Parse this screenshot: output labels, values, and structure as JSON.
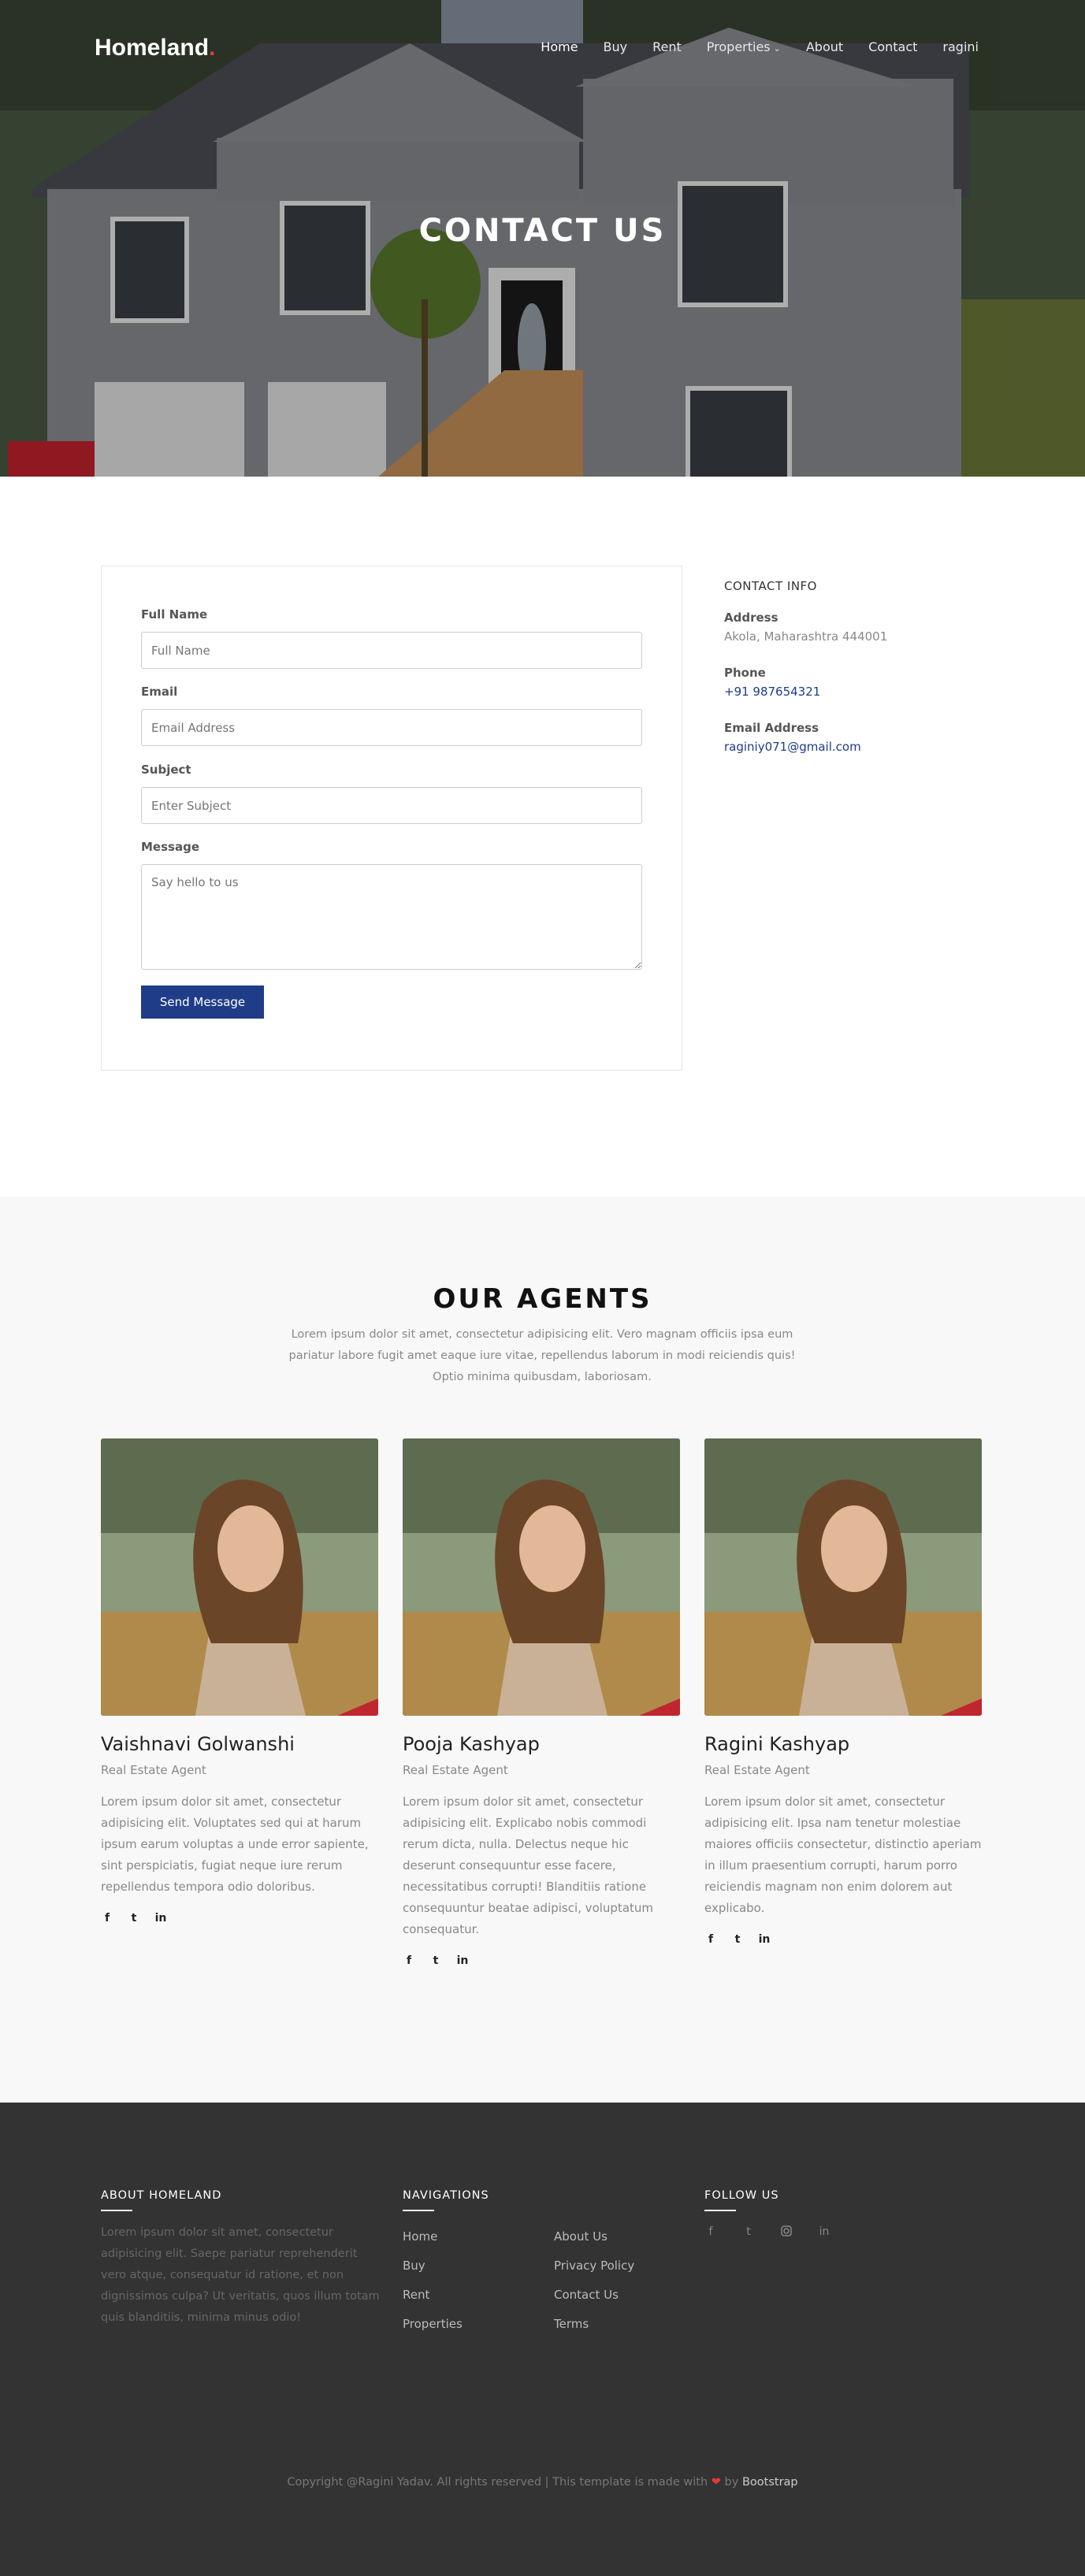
{
  "header": {
    "brand": "Homeland",
    "brand_dot": ".",
    "nav": [
      "Home",
      "Buy",
      "Rent",
      "Properties",
      "About",
      "Contact",
      "ragini"
    ],
    "nav_caret": "⌄"
  },
  "hero": {
    "title": "CONTACT US"
  },
  "form": {
    "full_name_label": "Full Name",
    "full_name_placeholder": "Full Name",
    "email_label": "Email",
    "email_placeholder": "Email Address",
    "subject_label": "Subject",
    "subject_placeholder": "Enter Subject",
    "message_label": "Message",
    "message_placeholder": "Say hello to us",
    "send_label": "Send Message"
  },
  "contact_info": {
    "title": "CONTACT INFO",
    "address_label": "Address",
    "address_value": "Akola, Maharashtra 444001",
    "phone_label": "Phone",
    "phone_value": "+91 987654321",
    "email_label": "Email Address",
    "email_value": "raginiy071@gmail.com"
  },
  "agents": {
    "title": "OUR AGENTS",
    "lead": "Lorem ipsum dolor sit amet, consectetur adipisicing elit. Vero magnam officiis ipsa eum pariatur labore fugit amet eaque iure vitae, repellendus laborum in modi reiciendis quis! Optio minima quibusdam, laboriosam.",
    "items": [
      {
        "name": "Vaishnavi Golwanshi",
        "role": "Real Estate Agent",
        "bio": "Lorem ipsum dolor sit amet, consectetur adipisicing elit. Voluptates sed qui at harum ipsum earum voluptas a unde error sapiente, sint perspiciatis, fugiat neque iure rerum repellendus tempora odio doloribus."
      },
      {
        "name": "Pooja Kashyap",
        "role": "Real Estate Agent",
        "bio": "Lorem ipsum dolor sit amet, consectetur adipisicing elit. Explicabo nobis commodi rerum dicta, nulla. Delectus neque hic deserunt consequuntur esse facere, necessitatibus corrupti! Blanditiis ratione consequuntur beatae adipisci, voluptatum consequatur."
      },
      {
        "name": "Ragini Kashyap",
        "role": "Real Estate Agent",
        "bio": "Lorem ipsum dolor sit amet, consectetur adipisicing elit. Ipsa nam tenetur molestiae maiores officiis consectetur, distinctio aperiam in illum praesentium corrupti, harum porro reiciendis magnam non enim dolorem aut explicabo."
      }
    ],
    "socials": [
      "f",
      "t",
      "in"
    ]
  },
  "footer": {
    "about_title": "ABOUT HOMELAND",
    "about_text": "Lorem ipsum dolor sit amet, consectetur adipisicing elit. Saepe pariatur reprehenderit vero atque, consequatur id ratione, et non dignissimos culpa? Ut veritatis, quos illum totam quis blanditiis, minima minus odio!",
    "nav_title": "NAVIGATIONS",
    "nav_col1": [
      "Home",
      "Buy",
      "Rent",
      "Properties"
    ],
    "nav_col2": [
      "About Us",
      "Privacy Policy",
      "Contact Us",
      "Terms"
    ],
    "follow_title": "FOLLOW US",
    "follow_icons": [
      "facebook-icon",
      "twitter-icon",
      "instagram-icon",
      "linkedin-icon"
    ],
    "copyright_pre": "Copyright @Ragini Yadav. All rights reserved | This template is made with",
    "copyright_by": "by",
    "copyright_brand": "Bootstrap"
  },
  "colors": {
    "accent": "#1f3c88",
    "footer_bg": "#333333",
    "agents_bg": "#f8f8f8"
  }
}
